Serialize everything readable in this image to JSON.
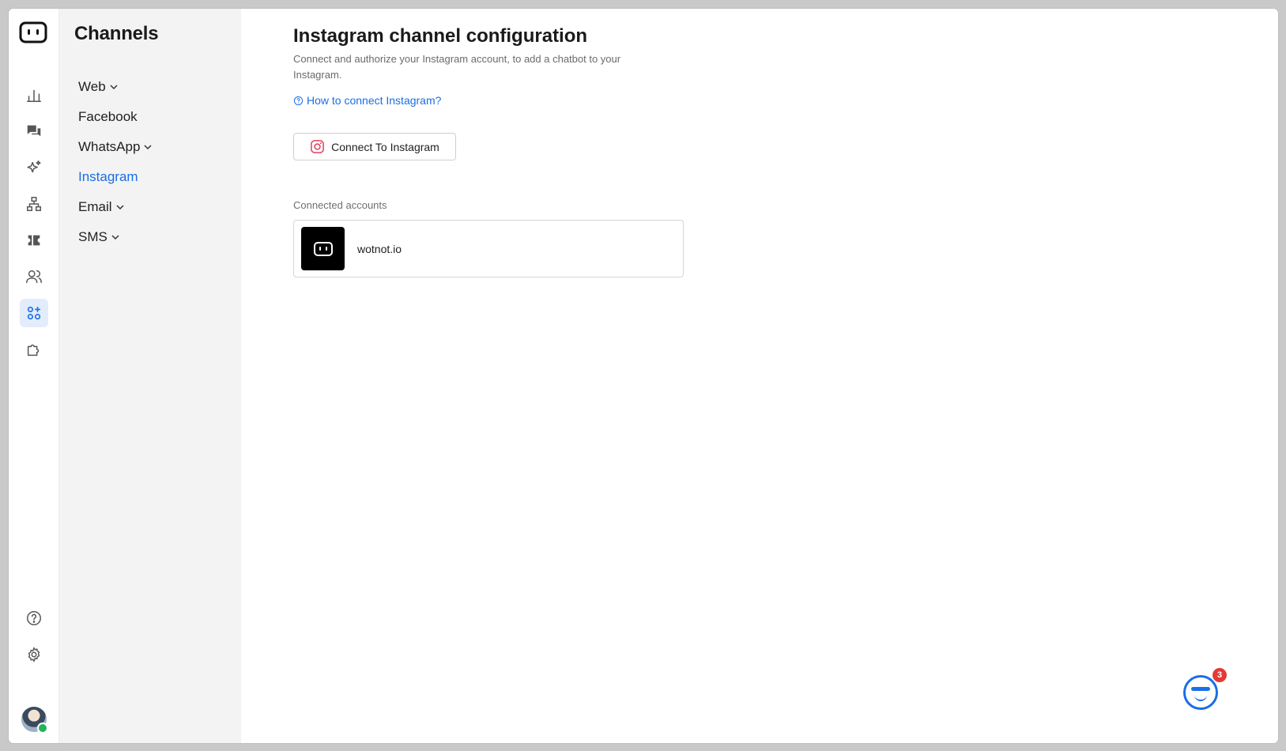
{
  "sidebar": {
    "title": "Channels",
    "items": [
      {
        "label": "Web",
        "expandable": true,
        "active": false
      },
      {
        "label": "Facebook",
        "expandable": false,
        "active": false
      },
      {
        "label": "WhatsApp",
        "expandable": true,
        "active": false
      },
      {
        "label": "Instagram",
        "expandable": false,
        "active": true
      },
      {
        "label": "Email",
        "expandable": true,
        "active": false
      },
      {
        "label": "SMS",
        "expandable": true,
        "active": false
      }
    ]
  },
  "rail": {
    "icons": [
      "analytics-icon",
      "conversations-icon",
      "ai-sparkle-icon",
      "flow-builder-icon",
      "tickets-icon",
      "contacts-icon",
      "channels-icon",
      "integrations-icon",
      "help-icon",
      "settings-icon"
    ],
    "active": "channels-icon",
    "user_online": true
  },
  "main": {
    "title": "Instagram channel configuration",
    "description": "Connect and authorize your Instagram account, to add a chatbot to your Instagram.",
    "help_link": "How to connect Instagram?",
    "connect_button": "Connect To Instagram",
    "connected_label": "Connected accounts",
    "accounts": [
      {
        "name": "wotnot.io"
      }
    ]
  },
  "chat_widget": {
    "badge_count": "3"
  },
  "colors": {
    "accent": "#1a6ee8",
    "sidebar_bg": "#f3f3f3",
    "badge": "#e53935",
    "online": "#22b35e"
  }
}
